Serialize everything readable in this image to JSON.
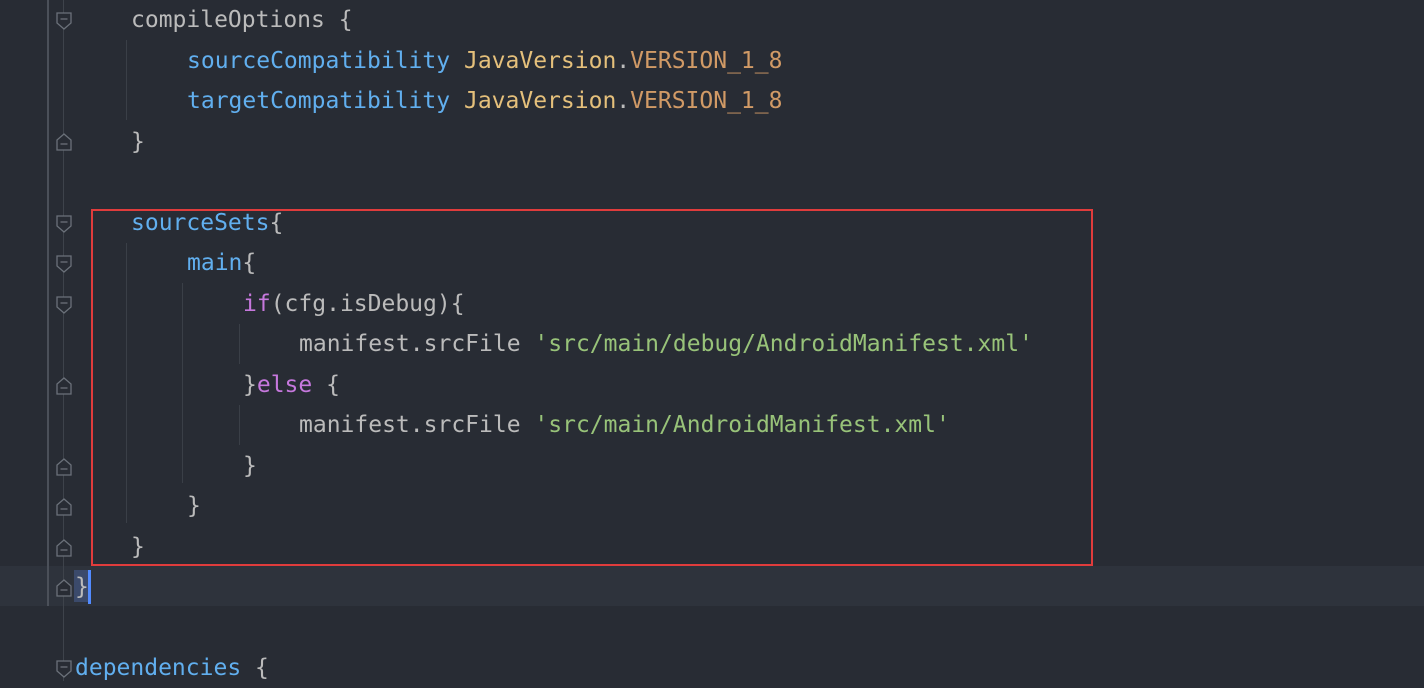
{
  "code_lines": [
    {
      "id": "l1",
      "tokens": [
        {
          "text": "compileOptions {",
          "cls": "plain"
        }
      ]
    },
    {
      "id": "l2",
      "tokens": [
        {
          "text": "sourceCompatibility",
          "cls": "kw-prop"
        },
        {
          "text": " ",
          "cls": "plain"
        },
        {
          "text": "JavaVersion",
          "cls": "kw-class"
        },
        {
          "text": ".",
          "cls": "plain"
        },
        {
          "text": "VERSION_1_8",
          "cls": "kw-const"
        }
      ]
    },
    {
      "id": "l3",
      "tokens": [
        {
          "text": "targetCompatibility",
          "cls": "kw-prop"
        },
        {
          "text": " ",
          "cls": "plain"
        },
        {
          "text": "JavaVersion",
          "cls": "kw-class"
        },
        {
          "text": ".",
          "cls": "plain"
        },
        {
          "text": "VERSION_1_8",
          "cls": "kw-const"
        }
      ]
    },
    {
      "id": "l4",
      "tokens": [
        {
          "text": "}",
          "cls": "plain"
        }
      ]
    },
    {
      "id": "l5",
      "tokens": []
    },
    {
      "id": "l6",
      "tokens": [
        {
          "text": "sourceSets",
          "cls": "kw-prop"
        },
        {
          "text": "{",
          "cls": "plain"
        }
      ]
    },
    {
      "id": "l7",
      "tokens": [
        {
          "text": "main",
          "cls": "kw-prop"
        },
        {
          "text": "{",
          "cls": "plain"
        }
      ]
    },
    {
      "id": "l8",
      "tokens": [
        {
          "text": "if",
          "cls": "kw-ctrl"
        },
        {
          "text": "(cfg.isDebug){",
          "cls": "plain"
        }
      ]
    },
    {
      "id": "l9",
      "tokens": [
        {
          "text": "manifest.srcFile ",
          "cls": "plain"
        },
        {
          "text": "'src/main/debug/AndroidManifest.xml'",
          "cls": "str"
        }
      ]
    },
    {
      "id": "l10",
      "tokens": [
        {
          "text": "}",
          "cls": "plain"
        },
        {
          "text": "else",
          "cls": "kw-ctrl"
        },
        {
          "text": " {",
          "cls": "plain"
        }
      ]
    },
    {
      "id": "l11",
      "tokens": [
        {
          "text": "manifest.srcFile ",
          "cls": "plain"
        },
        {
          "text": "'src/main/AndroidManifest.xml'",
          "cls": "str"
        }
      ]
    },
    {
      "id": "l12",
      "tokens": [
        {
          "text": "}",
          "cls": "plain"
        }
      ]
    },
    {
      "id": "l13",
      "tokens": [
        {
          "text": "}",
          "cls": "plain"
        }
      ]
    },
    {
      "id": "l14",
      "tokens": [
        {
          "text": "}",
          "cls": "plain"
        }
      ]
    },
    {
      "id": "l15",
      "tokens": [
        {
          "text": "}",
          "cls": "plain"
        }
      ]
    },
    {
      "id": "l16",
      "tokens": []
    },
    {
      "id": "l17",
      "tokens": [
        {
          "text": "dependencies",
          "cls": "kw-prop"
        },
        {
          "text": " {",
          "cls": "plain"
        }
      ]
    }
  ],
  "colors": {
    "background": "#282c34",
    "current_line": "#2e333c",
    "property": "#61afef",
    "class": "#e5c07b",
    "constant": "#d19a66",
    "control": "#c678dd",
    "string": "#98c379",
    "text": "#bbbbbb",
    "highlight_border": "#e03c3c",
    "caret": "#528bff"
  },
  "icons": {
    "fold_open": "fold-open-icon",
    "fold_close": "fold-close-icon"
  }
}
